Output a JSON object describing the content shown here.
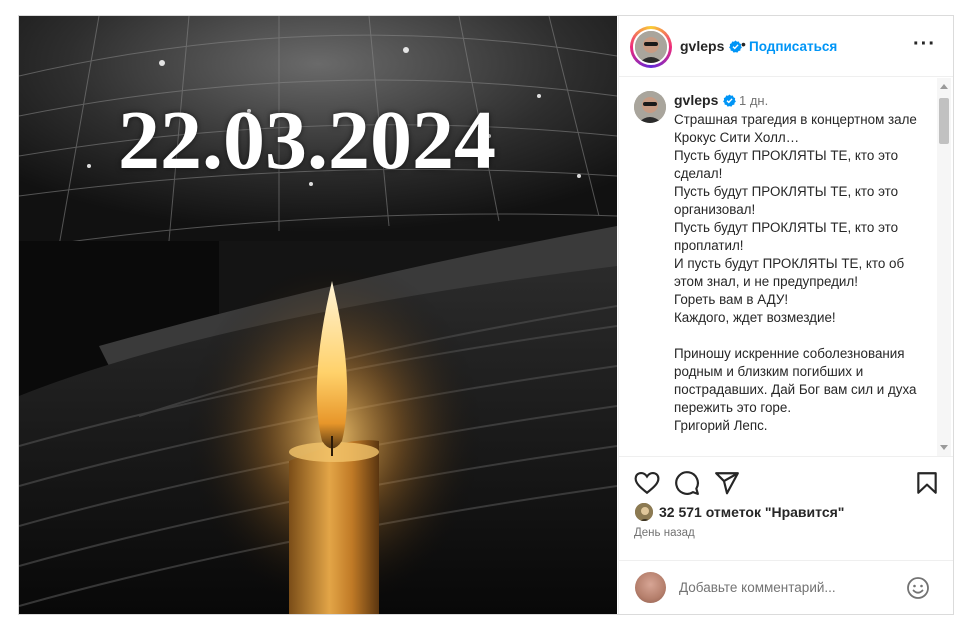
{
  "post": {
    "image_overlay_text": "22.03.2024"
  },
  "header": {
    "username": "gvleps",
    "separator": "•",
    "follow_label": "Подписаться",
    "more_label": "···"
  },
  "caption": {
    "username": "gvleps",
    "time": "1 дн.",
    "lines": [
      "Страшная трагедия в концертном зале Крокус Сити Холл…",
      "Пусть будут ПРОКЛЯТЫ ТЕ, кто это сделал!",
      "Пусть будут ПРОКЛЯТЫ ТЕ, кто это организовал!",
      "Пусть будут ПРОКЛЯТЫ ТЕ, кто это проплатил!",
      "И пусть будут ПРОКЛЯТЫ ТЕ, кто об этом знал, и не предупредил!",
      "Гореть вам в АДУ!",
      "Каждого, ждет возмездие!",
      "",
      "Приношу искренние соболезнования родным и близким погибших и пострадавших. Дай Бог вам сил и духа пережить это горе.",
      "Григорий Лепс."
    ]
  },
  "actions": {
    "like_icon": "heart-icon",
    "comment_icon": "comment-icon",
    "share_icon": "share-icon",
    "save_icon": "bookmark-icon"
  },
  "likes": {
    "text": "32 571 отметок \"Нравится\""
  },
  "timestamp": "День назад",
  "comment_box": {
    "placeholder": "Добавьте комментарий...",
    "emoji_icon": "emoji-icon"
  },
  "colors": {
    "accent": "#0095f6",
    "verified": "#0095f6",
    "text": "#262626",
    "muted": "#737373"
  }
}
